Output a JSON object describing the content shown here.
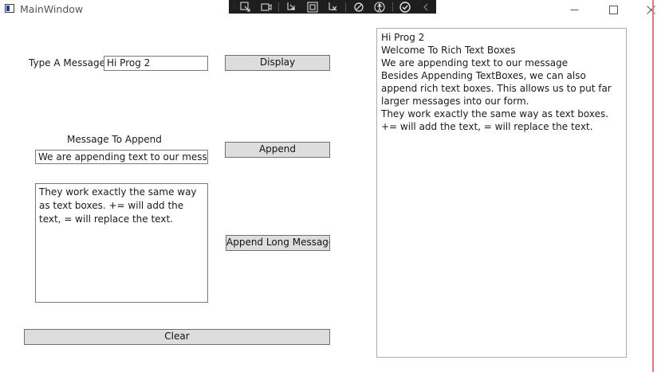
{
  "window": {
    "title": "MainWindow"
  },
  "form": {
    "type_message_label": "Type A Message",
    "type_message_value": "Hi Prog 2",
    "display_button": "Display",
    "append_label": "Message To Append",
    "append_value": "We are appending text to our message",
    "append_button": "Append",
    "long_message_value": "They work exactly the same way as text boxes. += will add the text, = will replace the text.",
    "append_long_button": "Append Long Message",
    "clear_button": "Clear",
    "rich_text": "Hi Prog 2\nWelcome To Rich Text Boxes\nWe are appending text to our message\nBesides Appending TextBoxes, we can also append rich text boxes. This allows us to put far larger messages into our form.\nThey work exactly the same way as text boxes. += will add the text, = will replace the text."
  },
  "devtools": {
    "icons": [
      "select-element-icon",
      "display-layout-adorners-icon",
      "track-focused-element-icon",
      "binding-failures-icon",
      "hot-reload-icon",
      "accessibility-icon",
      "xaml-check-icon",
      "collapse-icon"
    ]
  },
  "colors": {
    "button_bg": "#dddddd",
    "toolbar_bg": "#1e1e1e",
    "edge_accent": "#e87878"
  }
}
